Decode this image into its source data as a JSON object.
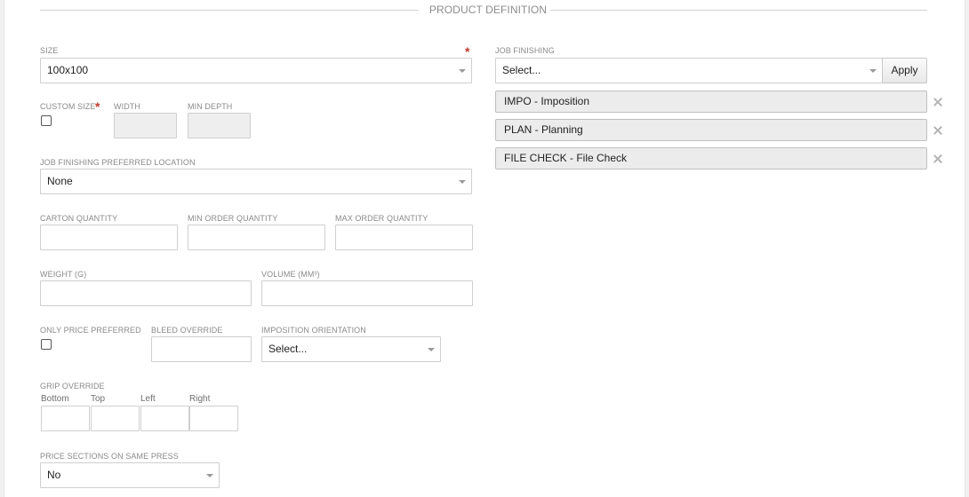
{
  "section": {
    "title": "PRODUCT DEFINITION"
  },
  "size": {
    "label": "SIZE",
    "value": "100x100",
    "required_mark": "*"
  },
  "custom_size": {
    "label": "CUSTOM SIZE",
    "required_mark": "*",
    "checked": false
  },
  "width": {
    "label": "WIDTH",
    "value": ""
  },
  "min_depth": {
    "label": "MIN DEPTH",
    "value": ""
  },
  "job_finishing_location": {
    "label": "JOB FINISHING PREFERRED LOCATION",
    "value": "None"
  },
  "carton_quantity": {
    "label": "CARTON QUANTITY",
    "value": ""
  },
  "min_order_quantity": {
    "label": "MIN ORDER QUANTITY",
    "value": ""
  },
  "max_order_quantity": {
    "label": "MAX ORDER QUANTITY",
    "value": ""
  },
  "weight": {
    "label": "WEIGHT (G)",
    "value": ""
  },
  "volume": {
    "label": "VOLUME (MM³)",
    "value": ""
  },
  "only_price_preferred": {
    "label": "ONLY PRICE PREFERRED",
    "checked": false
  },
  "bleed_override": {
    "label": "BLEED OVERRIDE",
    "value": ""
  },
  "imposition_orientation": {
    "label": "IMPOSITION ORIENTATION",
    "value": "Select..."
  },
  "grip_override": {
    "label": "GRIP OVERRIDE",
    "sides": [
      {
        "label": "Bottom",
        "value": ""
      },
      {
        "label": "Top",
        "value": ""
      },
      {
        "label": "Left",
        "value": ""
      },
      {
        "label": "Right",
        "value": ""
      }
    ]
  },
  "price_sections_same_press": {
    "label": "PRICE SECTIONS ON SAME PRESS",
    "value": "No"
  },
  "job_finishing": {
    "label": "JOB FINISHING",
    "select_value": "Select...",
    "apply_label": "Apply",
    "items": [
      {
        "label": "IMPO - Imposition"
      },
      {
        "label": "PLAN - Planning"
      },
      {
        "label": "FILE CHECK - File Check"
      }
    ]
  },
  "icons": {
    "remove": "close-icon",
    "dropdown": "chevron-down-icon"
  },
  "colors": {
    "required": "#c0392b",
    "border": "#cfcfcf",
    "tag_bg": "#ececec"
  }
}
